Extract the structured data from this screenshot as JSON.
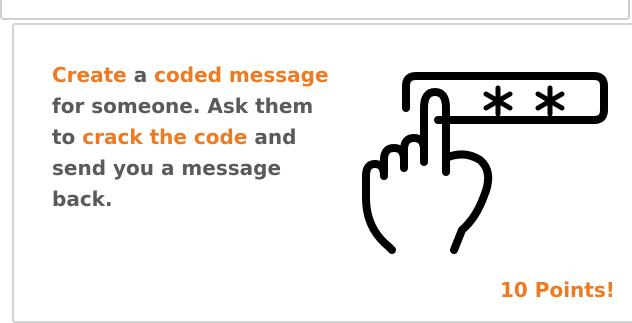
{
  "message": {
    "segments": [
      {
        "text": "Create",
        "highlight": true
      },
      {
        "text": " a ",
        "highlight": false
      },
      {
        "text": "coded message",
        "highlight": true
      },
      {
        "text": " for someone. Ask them to ",
        "highlight": false
      },
      {
        "text": "crack the code",
        "highlight": true
      },
      {
        "text": " and send you a message back.",
        "highlight": false
      }
    ]
  },
  "illustration": {
    "icon": "hand-tapping-password-icon",
    "password_mask": "✱ ✱"
  },
  "reward": {
    "points_label": "10 Points!"
  },
  "colors": {
    "accent": "#ee7a22",
    "body_text": "#5a5a5a",
    "card_border": "#d4d4d4",
    "icon": "#000000"
  }
}
